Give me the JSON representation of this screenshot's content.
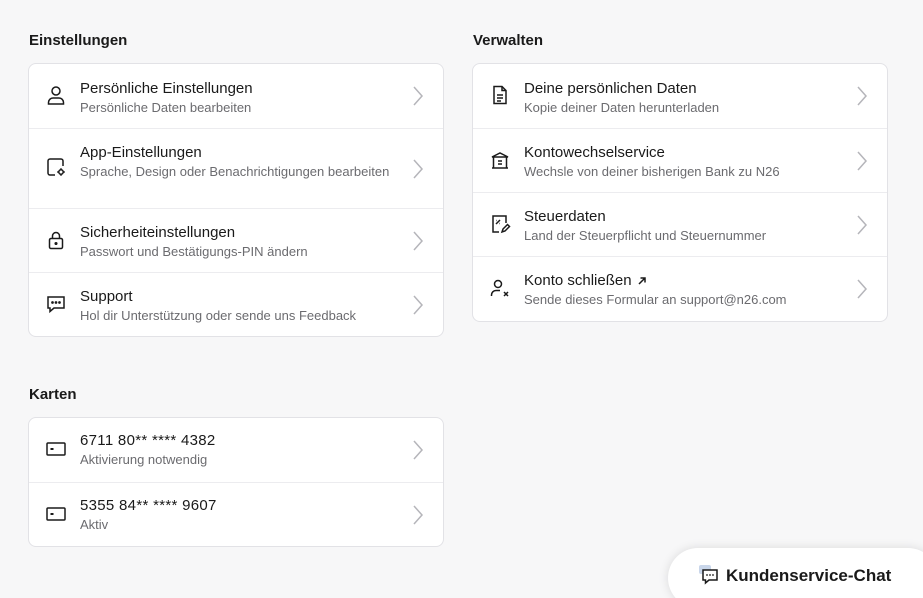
{
  "settings": {
    "heading": "Einstellungen",
    "items": [
      {
        "title": "Persönliche Einstellungen",
        "subtitle": "Persönliche Daten bearbeiten",
        "icon": "person-icon"
      },
      {
        "title": "App-Einstellungen",
        "subtitle": "Sprache, Design oder Benachrichtigungen bearbeiten",
        "icon": "app-settings-icon"
      },
      {
        "title": "Sicherheiteinstellungen",
        "subtitle": "Passwort und Bestätigungs-PIN ändern",
        "icon": "lock-icon"
      },
      {
        "title": "Support",
        "subtitle": "Hol dir Unterstützung oder sende uns Feedback",
        "icon": "chat-bubble-icon"
      }
    ]
  },
  "manage": {
    "heading": "Verwalten",
    "items": [
      {
        "title": "Deine persönlichen Daten",
        "subtitle": "Kopie deiner Daten herunterladen",
        "icon": "document-icon"
      },
      {
        "title": "Kontowechselservice",
        "subtitle": "Wechsle von deiner bisherigen Bank zu N26",
        "icon": "bank-icon"
      },
      {
        "title": "Steuerdaten",
        "subtitle": "Land der Steuerpflicht und Steuernummer",
        "icon": "tax-document-icon"
      },
      {
        "title": "Konto schließen",
        "subtitle": "Sende dieses Formular an support@n26.com",
        "icon": "person-remove-icon"
      }
    ]
  },
  "cards": {
    "heading": "Karten",
    "items": [
      {
        "title": "6711 80** **** 4382",
        "subtitle": "Aktivierung notwendig",
        "icon": "card-icon"
      },
      {
        "title": "5355 84** **** 9607",
        "subtitle": "Aktiv",
        "icon": "card-icon"
      }
    ]
  },
  "chat": {
    "label": "Kundenservice-Chat",
    "icon": "chat-icon"
  },
  "colors": {
    "background": "#f7f7f8",
    "card": "#ffffff",
    "border": "#e2e2e6",
    "text": "#1a1a1a",
    "subtext": "#6b6b6f",
    "chevron": "#b5b5ba"
  }
}
